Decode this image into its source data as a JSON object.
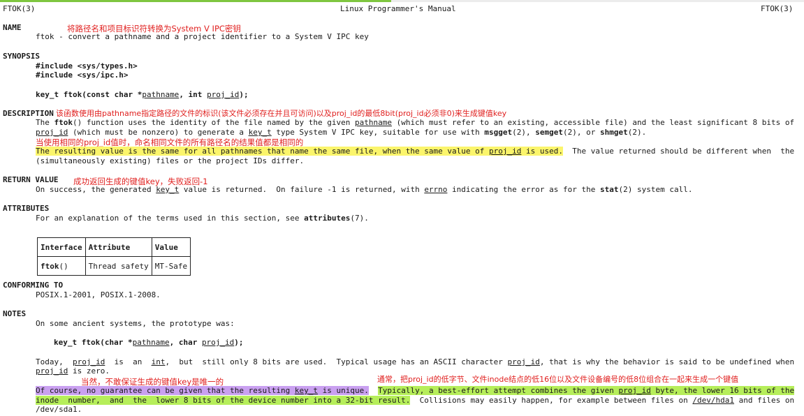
{
  "colors": {
    "annotation": "#e0201f",
    "highlight_yellow": "#fbf56b",
    "highlight_purple": "#c9a0f0",
    "highlight_green": "#b6ee5a",
    "top_accent": "#7fc640"
  },
  "header": {
    "left": "FTOK(3)",
    "center": "Linux Programmer's Manual",
    "right": "FTOK(3)"
  },
  "name": {
    "heading": "NAME",
    "annotation": "将路径名和项目标识符转换为System V IPC密钥",
    "text": "ftok - convert a pathname and a project identifier to a System V IPC key"
  },
  "synopsis": {
    "heading": "SYNOPSIS",
    "include1": "#include <sys/types.h>",
    "include2": "#include <sys/ipc.h>",
    "proto_pre": "key_t ftok(const char *",
    "proto_arg1": "pathname",
    "proto_mid": ", int ",
    "proto_arg2": "proj_id",
    "proto_post": ");"
  },
  "description": {
    "heading": "DESCRIPTION",
    "annotation1": "该函数使用由pathname指定路径的文件的标识(该文件必须存在并且可访问)以及proj_id的最低8bit(proj_id必须非0)来生成键值key",
    "l1_a": "The ",
    "l1_b": "ftok",
    "l1_c": "() function uses the identity of the file named by the given ",
    "l1_d": "pathname",
    "l1_e": " (which must refer to an existing, accessible file) and the least significant 8 bits of",
    "l2_a": "proj_id",
    "l2_b": " (which must be nonzero) to generate a ",
    "l2_c": "key_t",
    "l2_d": " type System V IPC key, suitable for use with ",
    "l2_e": "msgget",
    "l2_f": "(2), ",
    "l2_g": "semget",
    "l2_h": "(2), or ",
    "l2_i": "shmget",
    "l2_j": "(2).",
    "annotation2": "当使用相同的proj_id值时，命名相同文件的所有路径名的结果值都是相同的",
    "l3_a": "The resulting value is the same for all pathnames that name the same file, when the same value of ",
    "l3_b": "proj_id",
    "l3_c": " is used.",
    "l3_d": "  The value returned should be different when  the",
    "l4": "(simultaneously existing) files or the project IDs differ."
  },
  "return_value": {
    "heading": "RETURN VALUE",
    "annotation": "成功返回生成的键值key，失败返回-1",
    "a": "On success, the generated ",
    "b": "key_t",
    "c": " value is returned.  On failure -1 is returned, with ",
    "d": "errno",
    "e": " indicating the error as for the ",
    "f": "stat",
    "g": "(2) system call."
  },
  "attributes": {
    "heading": "ATTRIBUTES",
    "a": "For an explanation of the terms used in this section, see ",
    "b": "attributes",
    "c": "(7).",
    "table": {
      "headers": [
        "Interface",
        "Attribute",
        "Value"
      ],
      "row": [
        "ftok",
        "()",
        "Thread safety",
        "MT-Safe"
      ]
    }
  },
  "conforming": {
    "heading": "CONFORMING TO",
    "text": "POSIX.1-2001, POSIX.1-2008."
  },
  "notes": {
    "heading": "NOTES",
    "p1": "On some ancient systems, the prototype was:",
    "proto_a": "key_t ftok(char *",
    "proto_b": "pathname",
    "proto_c": ", char ",
    "proto_d": "proj_id",
    "proto_e": ");",
    "t1_a": "Today,  ",
    "t1_b": "proj_id",
    "t1_c": "  is  an  ",
    "t1_d": "int",
    "t1_e": ",  but  still only 8 bits are used.  Typical usage has an ASCII character ",
    "t1_f": "proj_id",
    "t1_g": ", that is why the behavior is said to be undefined when",
    "t2_a": "proj_id",
    "t2_b": " is zero.",
    "annotation_left": "当然，不敢保证生成的键值key是唯一的",
    "annotation_right": "通常，把proj_id的低字节、文件inode结点的低16位以及文件设备编号的低8位组合在一起来生成一个键值",
    "t3_a": "Of course, no guarantee can be given that the resulting ",
    "t3_b": "key_t",
    "t3_c": " is unique.",
    "t3_d": "  ",
    "t3_e": "Typically, a best-effort attempt combines the given ",
    "t3_f": "proj_id",
    "t3_g": " byte, the lower 16 bits of the",
    "t4_a": "inode  number,  and  the  lower 8 bits of the device number into a 32-bit result.",
    "t4_b": "  Collisions may easily happen, for example between files on ",
    "t4_c": "/dev/hda1",
    "t4_d": " and files on",
    "t5": "/dev/sda1."
  }
}
